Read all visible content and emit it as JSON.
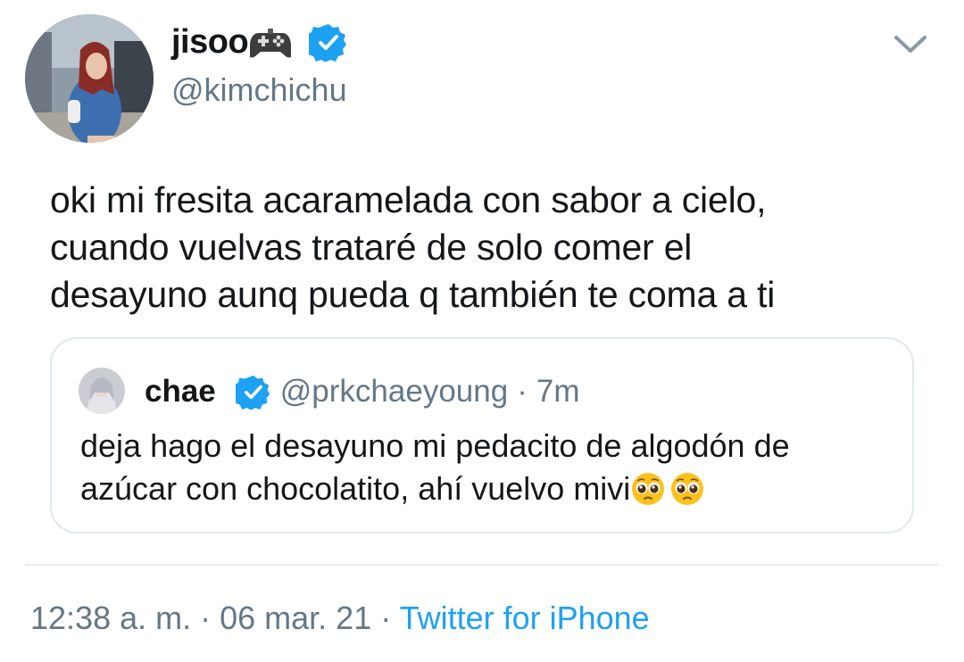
{
  "author": {
    "display_name": "jisoo",
    "name_emoji": "gamepad-icon",
    "verified": true,
    "handle": "@kimchichu"
  },
  "tweet": {
    "text_lines": [
      "oki mi fresita acaramelada con sabor a cielo,",
      "cuando vuelvas trataré de solo comer el",
      "desayuno aunq pueda q también te coma a ti"
    ]
  },
  "quoted_tweet": {
    "display_name": "chae",
    "verified": true,
    "handle": "@prkchaeyoung",
    "separator": "·",
    "time": "7m",
    "text_lines": [
      "deja hago el desayuno mi pedacito de algodón de",
      "azúcar con chocolatito, ahí vuelvo mivi"
    ],
    "trailing_emojis": [
      "pleading-face-icon",
      "pleading-face-icon"
    ]
  },
  "meta": {
    "time": "12:38 a. m.",
    "sep1": " · ",
    "date": "06 mar. 21",
    "sep2": " · ",
    "source": "Twitter for iPhone"
  },
  "colors": {
    "text": "#14171a",
    "secondary": "#657786",
    "link": "#1da1f2",
    "verified": "#1da1f2",
    "border": "#e1e8ed"
  }
}
